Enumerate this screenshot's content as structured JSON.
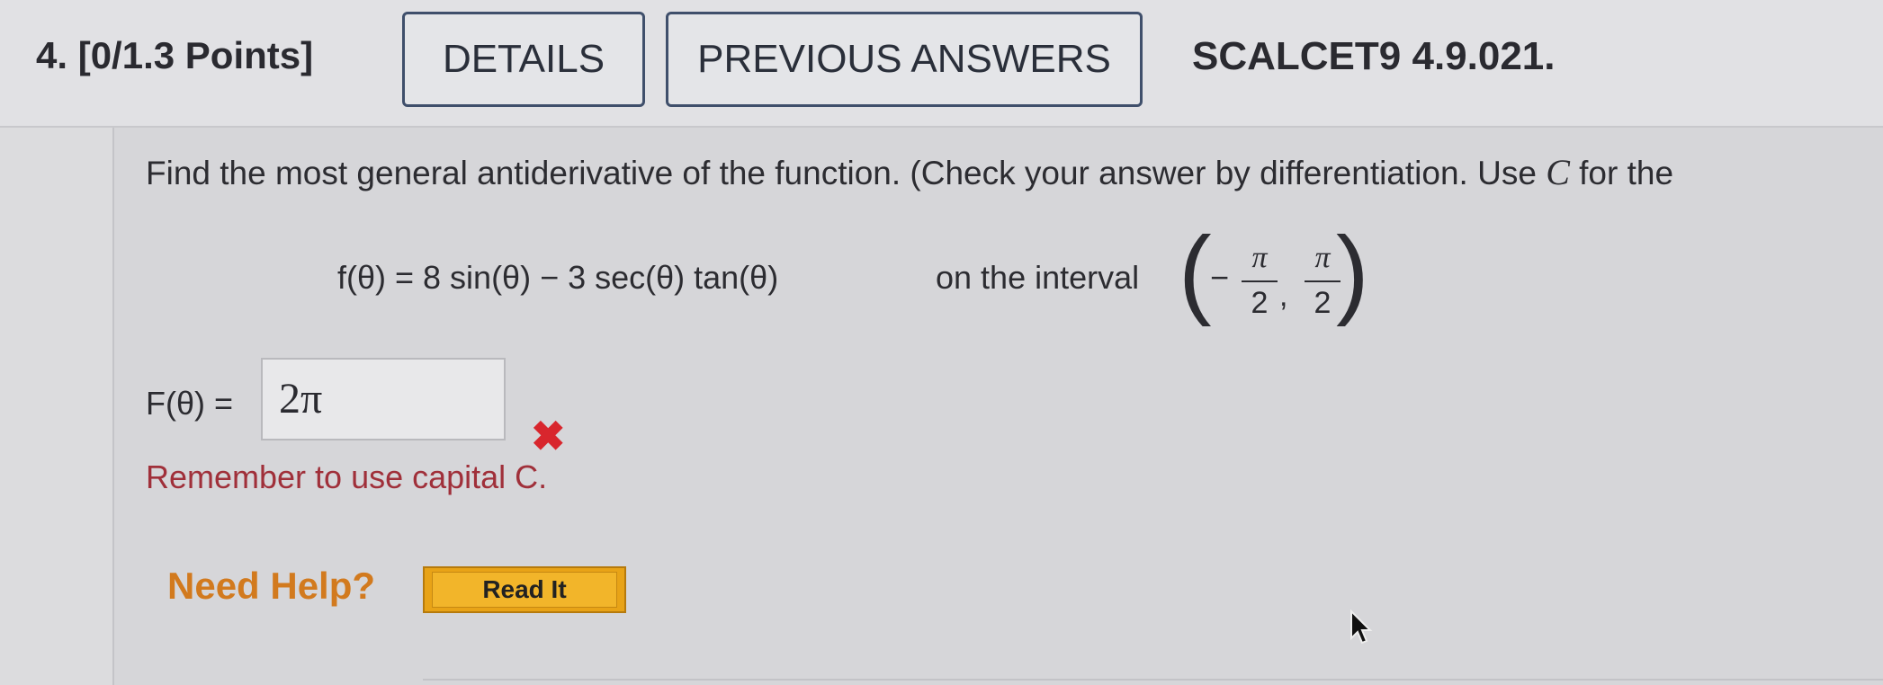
{
  "header": {
    "question_number": "4.",
    "points": "[0/1.3 Points]",
    "details_label": "DETAILS",
    "previous_answers_label": "PREVIOUS ANSWERS",
    "question_id": "SCALCET9 4.9.021."
  },
  "problem": {
    "instruction_start": "Find the most general antiderivative of the function. (Check your answer by differentiation. Use",
    "instruction_var": "C",
    "instruction_end": "for the",
    "function": "f(θ) = 8 sin(θ) − 3 sec(θ) tan(θ)",
    "interval_label": "on the interval",
    "interval": {
      "minus": "−",
      "pi": "π",
      "denominator": "2",
      "comma": ","
    }
  },
  "answer": {
    "label": "F(θ) =",
    "value": "2π",
    "status_icon": "x-mark-icon",
    "feedback": "Remember to use capital C."
  },
  "help": {
    "need_help": "Need Help?",
    "read_it_label": "Read It"
  },
  "colors": {
    "error_red": "#d8262d",
    "feedback_red": "#a0303a",
    "help_orange": "#d27a1e",
    "button_border": "#3f4f6b",
    "read_it_fill": "#e8a317"
  }
}
